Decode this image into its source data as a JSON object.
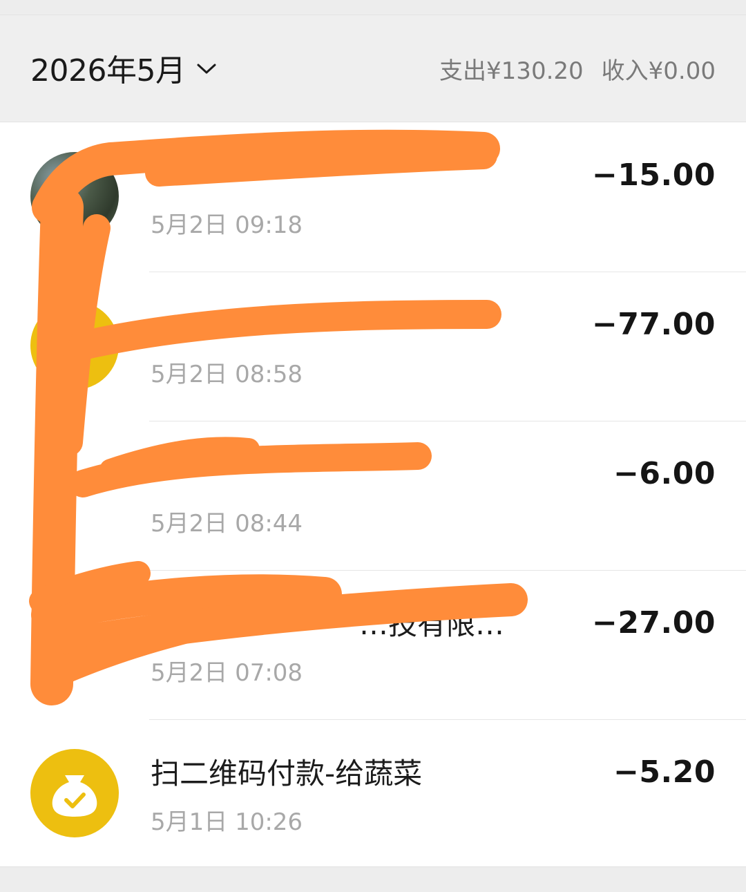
{
  "header": {
    "month": "2026年5月",
    "expense_label": "支出¥130.20",
    "income_label": "收入¥0.00"
  },
  "transactions": [
    {
      "title": "",
      "time": "5月2日 09:18",
      "amount": "−15.00",
      "avatar": "photo-avatar"
    },
    {
      "title": "",
      "time": "5月2日 08:58",
      "amount": "−77.00",
      "avatar": "yellow-avatar"
    },
    {
      "title": "",
      "time": "5月2日 08:44",
      "amount": "−6.00",
      "avatar": "green-avatar"
    },
    {
      "title": "…技有限…",
      "time": "5月2日 07:08",
      "amount": "−27.00",
      "avatar": "hidden-avatar"
    },
    {
      "title": "扫二维码付款-给蔬菜",
      "time": "5月1日 10:26",
      "amount": "−5.20",
      "avatar": "money-bag-icon"
    }
  ],
  "colors": {
    "accent_yellow": "#EDBF10",
    "redaction_orange": "#FF8C3A"
  }
}
